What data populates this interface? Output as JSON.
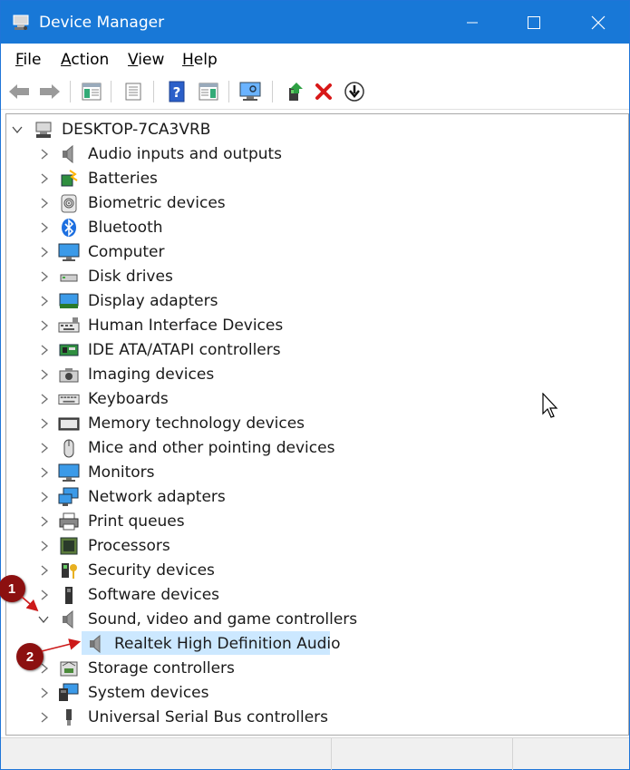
{
  "window": {
    "title": "Device Manager",
    "title_icon": "device-manager-icon"
  },
  "menu": {
    "file": "F",
    "file_rest": "ile",
    "action": "A",
    "action_rest": "ction",
    "view": "V",
    "view_rest": "iew",
    "help": "H",
    "help_rest": "elp"
  },
  "tree": {
    "root": "DESKTOP-7CA3VRB",
    "categories": [
      "Audio inputs and outputs",
      "Batteries",
      "Biometric devices",
      "Bluetooth",
      "Computer",
      "Disk drives",
      "Display adapters",
      "Human Interface Devices",
      "IDE ATA/ATAPI controllers",
      "Imaging devices",
      "Keyboards",
      "Memory technology devices",
      "Mice and other pointing devices",
      "Monitors",
      "Network adapters",
      "Print queues",
      "Processors",
      "Security devices",
      "Software devices",
      "Sound, video and game controllers",
      "Storage controllers",
      "System devices",
      "Universal Serial Bus controllers"
    ],
    "expanded_child": "Realtek High Definition Audio"
  },
  "annotations": {
    "badge1": "1",
    "badge2": "2"
  },
  "colors": {
    "titlebar": "#1878d7",
    "selection": "#cce8ff",
    "badge": "#8c1010",
    "arrow": "#cc1a1a"
  }
}
